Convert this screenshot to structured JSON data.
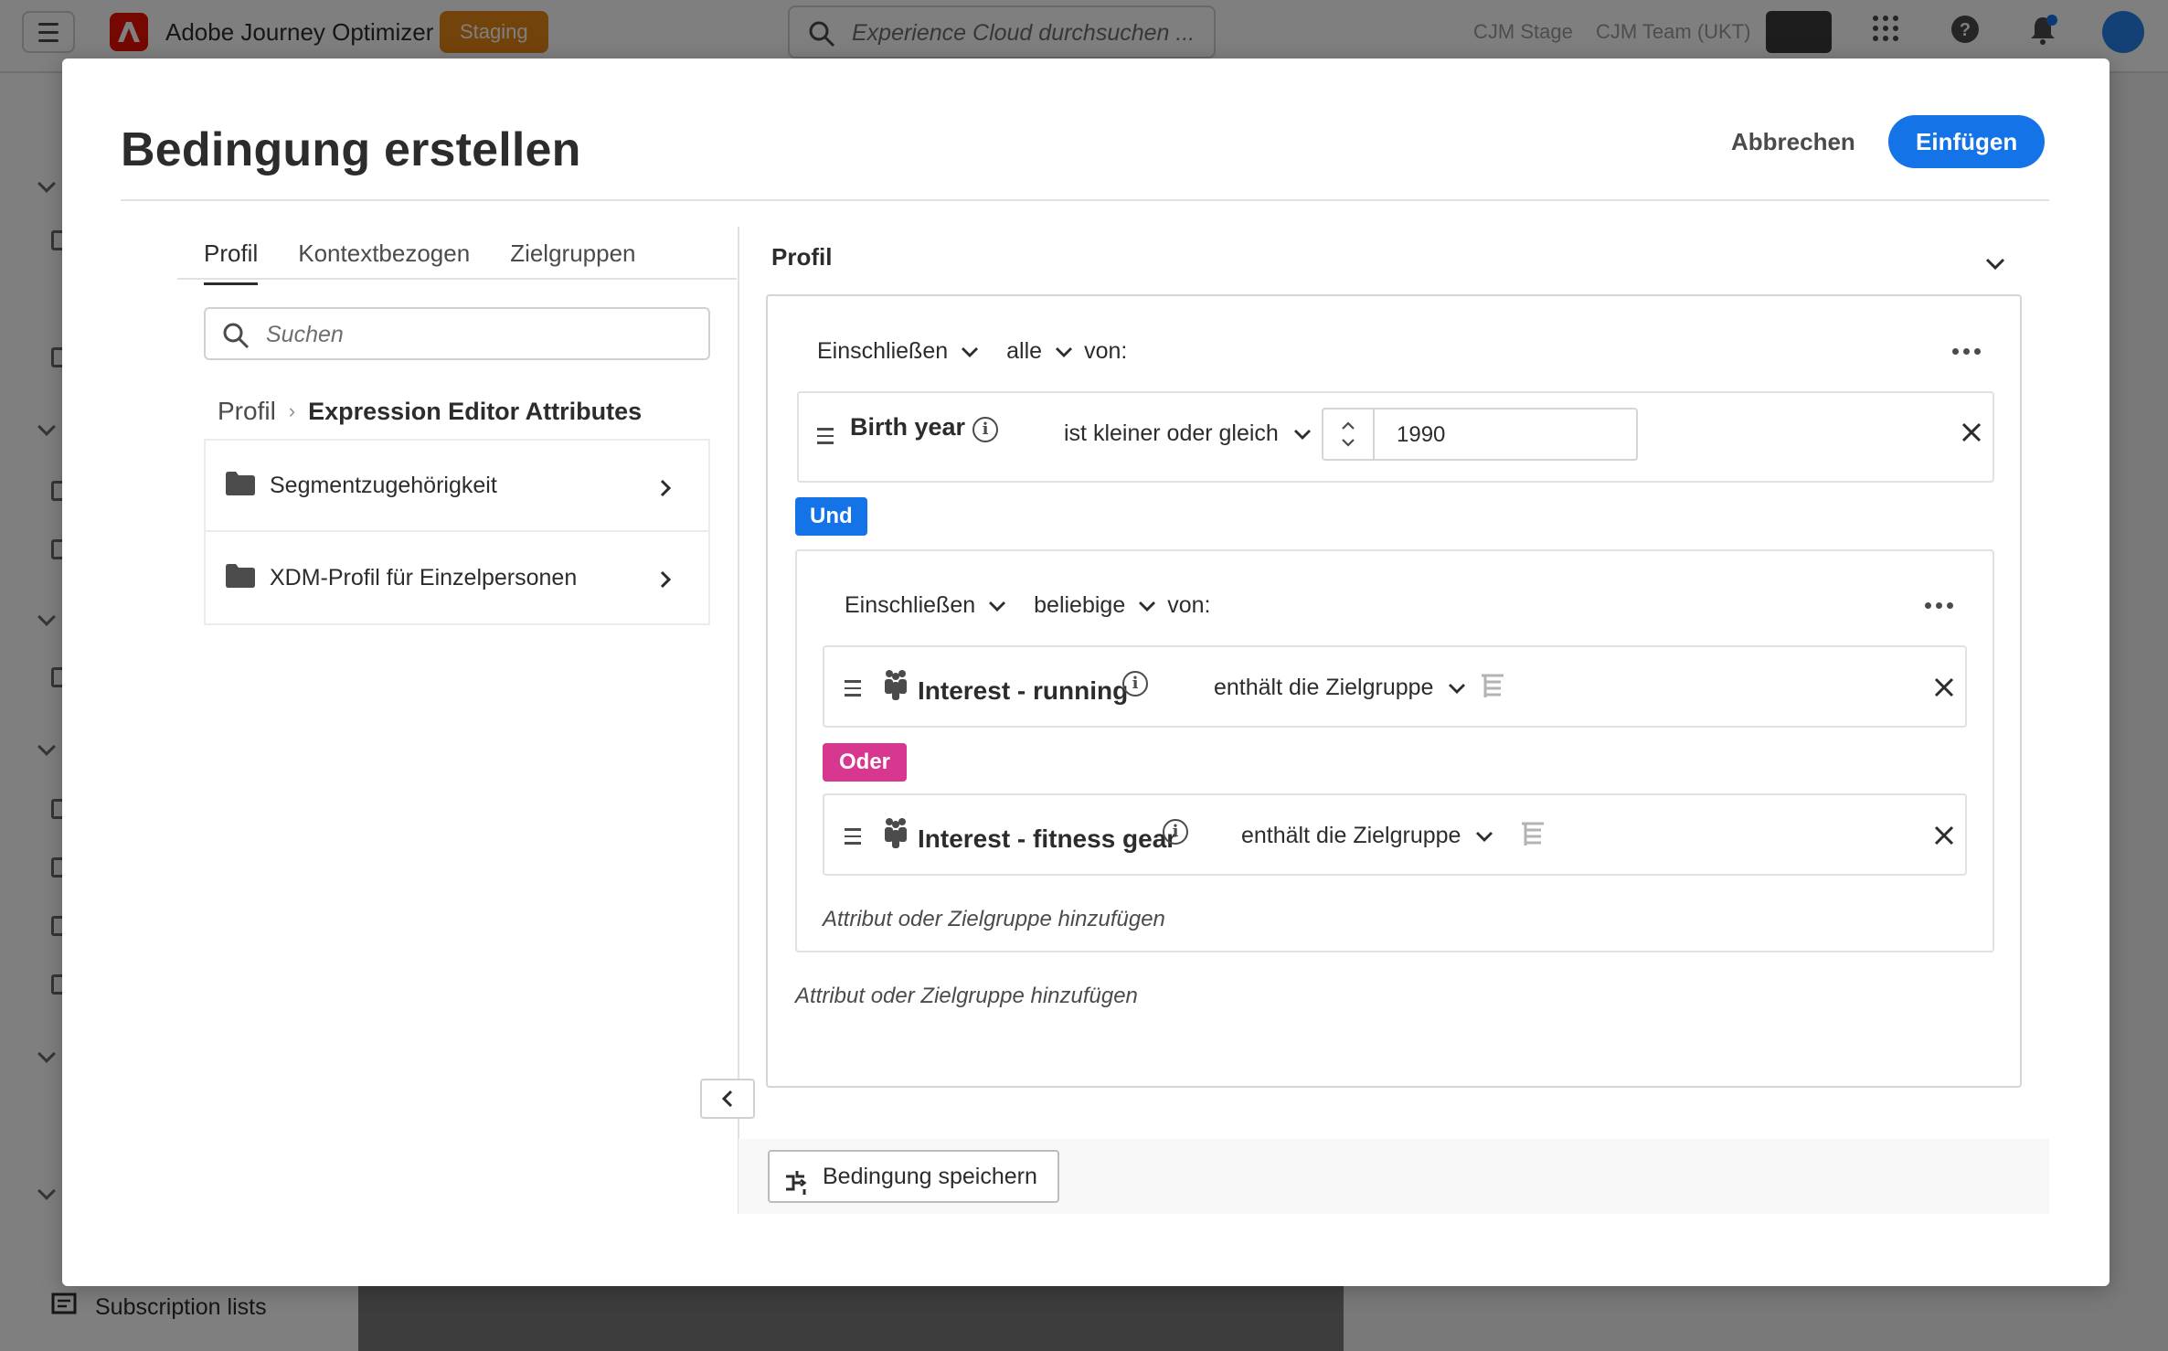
{
  "topbar": {
    "app_name": "Adobe Journey Optimizer",
    "env_badge": "Staging",
    "search_placeholder": "Experience Cloud durchsuchen ...",
    "sandbox_1": "CJM Stage",
    "sandbox_2": "CJM Team (UKT)",
    "icons": [
      "menu-icon",
      "adobe-logo",
      "search-icon",
      "apps-icon",
      "help-icon",
      "bell-icon",
      "avatar"
    ]
  },
  "leftnav": {
    "bottom_item": "Subscription lists"
  },
  "modal": {
    "title": "Bedingung erstellen",
    "cancel_label": "Abbrechen",
    "insert_label": "Einfügen",
    "tabs": [
      "Profil",
      "Kontextbezogen",
      "Zielgruppen"
    ],
    "active_tab": "Profil",
    "search_placeholder": "Suchen",
    "breadcrumb": {
      "root": "Profil",
      "current": "Expression Editor Attributes"
    },
    "folders": [
      "Segmentzugehörigkeit",
      "XDM-Profil für Einzelpersonen"
    ],
    "panel_title": "Profil",
    "outer_group": {
      "include": "Einschließen",
      "quantifier": "alle",
      "of": "von:",
      "condition": {
        "attribute": "Birth year",
        "operator": "ist kleiner oder gleich",
        "value": "1990"
      },
      "connector": "Und",
      "add_link": "Attribut oder Zielgruppe hinzufügen"
    },
    "inner_group": {
      "include": "Einschließen",
      "quantifier": "beliebige",
      "of": "von:",
      "conditions": [
        {
          "attribute": "Interest - running",
          "operator": "enthält die Zielgruppe"
        },
        {
          "attribute": "Interest - fitness gear",
          "operator": "enthält die Zielgruppe"
        }
      ],
      "connector": "Oder",
      "add_link": "Attribut oder Zielgruppe hinzufügen"
    },
    "save_condition_label": "Bedingung speichern"
  },
  "colors": {
    "accent_blue": "#1473e6",
    "or_pink": "#d83790",
    "staging_orange": "#e68619",
    "adobe_red": "#eb1000"
  }
}
